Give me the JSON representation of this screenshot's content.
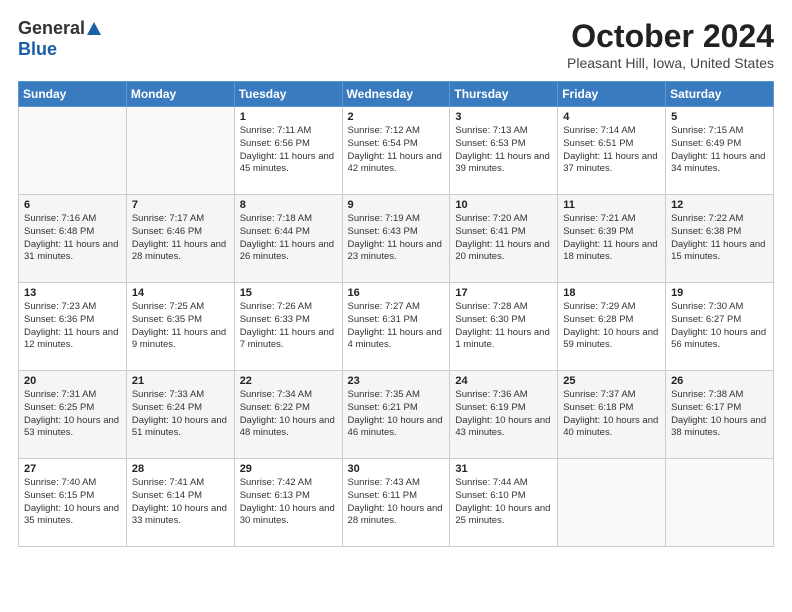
{
  "logo": {
    "general": "General",
    "blue": "Blue"
  },
  "header": {
    "title": "October 2024",
    "subtitle": "Pleasant Hill, Iowa, United States"
  },
  "weekdays": [
    "Sunday",
    "Monday",
    "Tuesday",
    "Wednesday",
    "Thursday",
    "Friday",
    "Saturday"
  ],
  "weeks": [
    [
      {
        "num": "",
        "info": ""
      },
      {
        "num": "",
        "info": ""
      },
      {
        "num": "1",
        "info": "Sunrise: 7:11 AM\nSunset: 6:56 PM\nDaylight: 11 hours and 45 minutes."
      },
      {
        "num": "2",
        "info": "Sunrise: 7:12 AM\nSunset: 6:54 PM\nDaylight: 11 hours and 42 minutes."
      },
      {
        "num": "3",
        "info": "Sunrise: 7:13 AM\nSunset: 6:53 PM\nDaylight: 11 hours and 39 minutes."
      },
      {
        "num": "4",
        "info": "Sunrise: 7:14 AM\nSunset: 6:51 PM\nDaylight: 11 hours and 37 minutes."
      },
      {
        "num": "5",
        "info": "Sunrise: 7:15 AM\nSunset: 6:49 PM\nDaylight: 11 hours and 34 minutes."
      }
    ],
    [
      {
        "num": "6",
        "info": "Sunrise: 7:16 AM\nSunset: 6:48 PM\nDaylight: 11 hours and 31 minutes."
      },
      {
        "num": "7",
        "info": "Sunrise: 7:17 AM\nSunset: 6:46 PM\nDaylight: 11 hours and 28 minutes."
      },
      {
        "num": "8",
        "info": "Sunrise: 7:18 AM\nSunset: 6:44 PM\nDaylight: 11 hours and 26 minutes."
      },
      {
        "num": "9",
        "info": "Sunrise: 7:19 AM\nSunset: 6:43 PM\nDaylight: 11 hours and 23 minutes."
      },
      {
        "num": "10",
        "info": "Sunrise: 7:20 AM\nSunset: 6:41 PM\nDaylight: 11 hours and 20 minutes."
      },
      {
        "num": "11",
        "info": "Sunrise: 7:21 AM\nSunset: 6:39 PM\nDaylight: 11 hours and 18 minutes."
      },
      {
        "num": "12",
        "info": "Sunrise: 7:22 AM\nSunset: 6:38 PM\nDaylight: 11 hours and 15 minutes."
      }
    ],
    [
      {
        "num": "13",
        "info": "Sunrise: 7:23 AM\nSunset: 6:36 PM\nDaylight: 11 hours and 12 minutes."
      },
      {
        "num": "14",
        "info": "Sunrise: 7:25 AM\nSunset: 6:35 PM\nDaylight: 11 hours and 9 minutes."
      },
      {
        "num": "15",
        "info": "Sunrise: 7:26 AM\nSunset: 6:33 PM\nDaylight: 11 hours and 7 minutes."
      },
      {
        "num": "16",
        "info": "Sunrise: 7:27 AM\nSunset: 6:31 PM\nDaylight: 11 hours and 4 minutes."
      },
      {
        "num": "17",
        "info": "Sunrise: 7:28 AM\nSunset: 6:30 PM\nDaylight: 11 hours and 1 minute."
      },
      {
        "num": "18",
        "info": "Sunrise: 7:29 AM\nSunset: 6:28 PM\nDaylight: 10 hours and 59 minutes."
      },
      {
        "num": "19",
        "info": "Sunrise: 7:30 AM\nSunset: 6:27 PM\nDaylight: 10 hours and 56 minutes."
      }
    ],
    [
      {
        "num": "20",
        "info": "Sunrise: 7:31 AM\nSunset: 6:25 PM\nDaylight: 10 hours and 53 minutes."
      },
      {
        "num": "21",
        "info": "Sunrise: 7:33 AM\nSunset: 6:24 PM\nDaylight: 10 hours and 51 minutes."
      },
      {
        "num": "22",
        "info": "Sunrise: 7:34 AM\nSunset: 6:22 PM\nDaylight: 10 hours and 48 minutes."
      },
      {
        "num": "23",
        "info": "Sunrise: 7:35 AM\nSunset: 6:21 PM\nDaylight: 10 hours and 46 minutes."
      },
      {
        "num": "24",
        "info": "Sunrise: 7:36 AM\nSunset: 6:19 PM\nDaylight: 10 hours and 43 minutes."
      },
      {
        "num": "25",
        "info": "Sunrise: 7:37 AM\nSunset: 6:18 PM\nDaylight: 10 hours and 40 minutes."
      },
      {
        "num": "26",
        "info": "Sunrise: 7:38 AM\nSunset: 6:17 PM\nDaylight: 10 hours and 38 minutes."
      }
    ],
    [
      {
        "num": "27",
        "info": "Sunrise: 7:40 AM\nSunset: 6:15 PM\nDaylight: 10 hours and 35 minutes."
      },
      {
        "num": "28",
        "info": "Sunrise: 7:41 AM\nSunset: 6:14 PM\nDaylight: 10 hours and 33 minutes."
      },
      {
        "num": "29",
        "info": "Sunrise: 7:42 AM\nSunset: 6:13 PM\nDaylight: 10 hours and 30 minutes."
      },
      {
        "num": "30",
        "info": "Sunrise: 7:43 AM\nSunset: 6:11 PM\nDaylight: 10 hours and 28 minutes."
      },
      {
        "num": "31",
        "info": "Sunrise: 7:44 AM\nSunset: 6:10 PM\nDaylight: 10 hours and 25 minutes."
      },
      {
        "num": "",
        "info": ""
      },
      {
        "num": "",
        "info": ""
      }
    ]
  ]
}
